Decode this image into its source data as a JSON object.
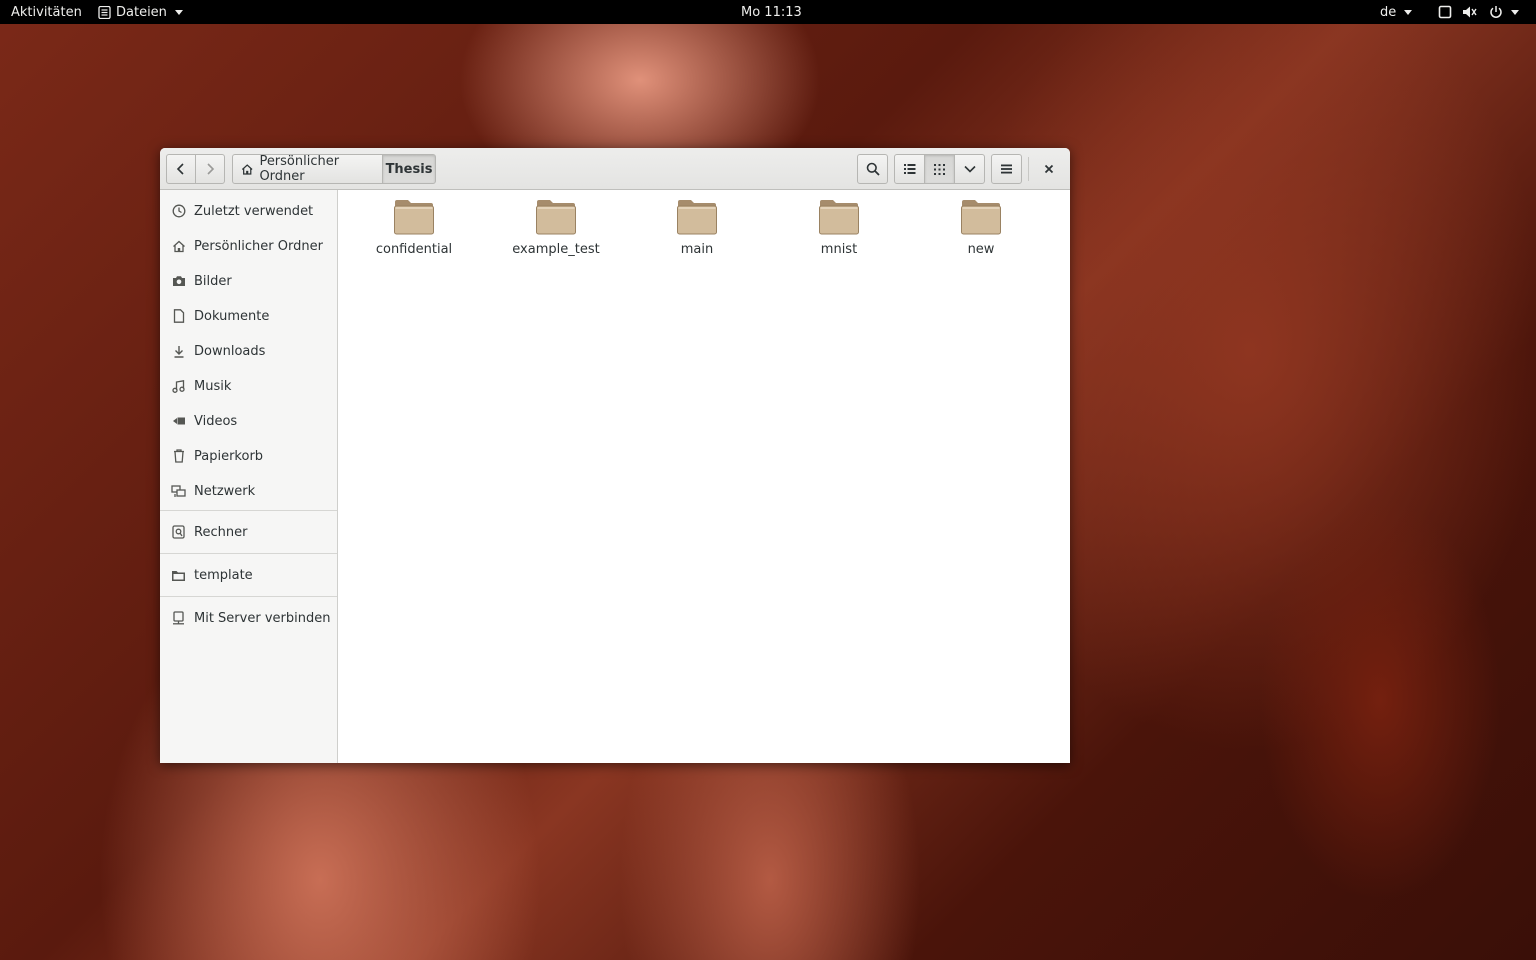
{
  "topbar": {
    "activities": "Aktivitäten",
    "app_menu": "Dateien",
    "clock": "Mo 11:13",
    "keyboard_layout": "de"
  },
  "window": {
    "breadcrumb": {
      "home_label": "Persönlicher Ordner",
      "current_label": "Thesis"
    }
  },
  "sidebar": {
    "places": [
      {
        "label": "Zuletzt verwendet",
        "icon": "clock-icon"
      },
      {
        "label": "Persönlicher Ordner",
        "icon": "home-icon"
      },
      {
        "label": "Bilder",
        "icon": "camera-icon"
      },
      {
        "label": "Dokumente",
        "icon": "document-icon"
      },
      {
        "label": "Downloads",
        "icon": "download-icon"
      },
      {
        "label": "Musik",
        "icon": "music-icon"
      },
      {
        "label": "Videos",
        "icon": "video-icon"
      },
      {
        "label": "Papierkorb",
        "icon": "trash-icon"
      },
      {
        "label": "Netzwerk",
        "icon": "network-icon"
      }
    ],
    "devices": [
      {
        "label": "Rechner",
        "icon": "computer-icon"
      }
    ],
    "bookmarks": [
      {
        "label": "template",
        "icon": "folder-icon"
      }
    ],
    "other": [
      {
        "label": "Mit Server verbinden",
        "icon": "server-icon"
      }
    ]
  },
  "files": [
    {
      "name": "confidential"
    },
    {
      "name": "example_test"
    },
    {
      "name": "main"
    },
    {
      "name": "mnist"
    },
    {
      "name": "new"
    }
  ],
  "colors": {
    "folder_fill": "#d2bc9c",
    "folder_tab": "#a68c6c",
    "topbar_bg": "#000000"
  }
}
